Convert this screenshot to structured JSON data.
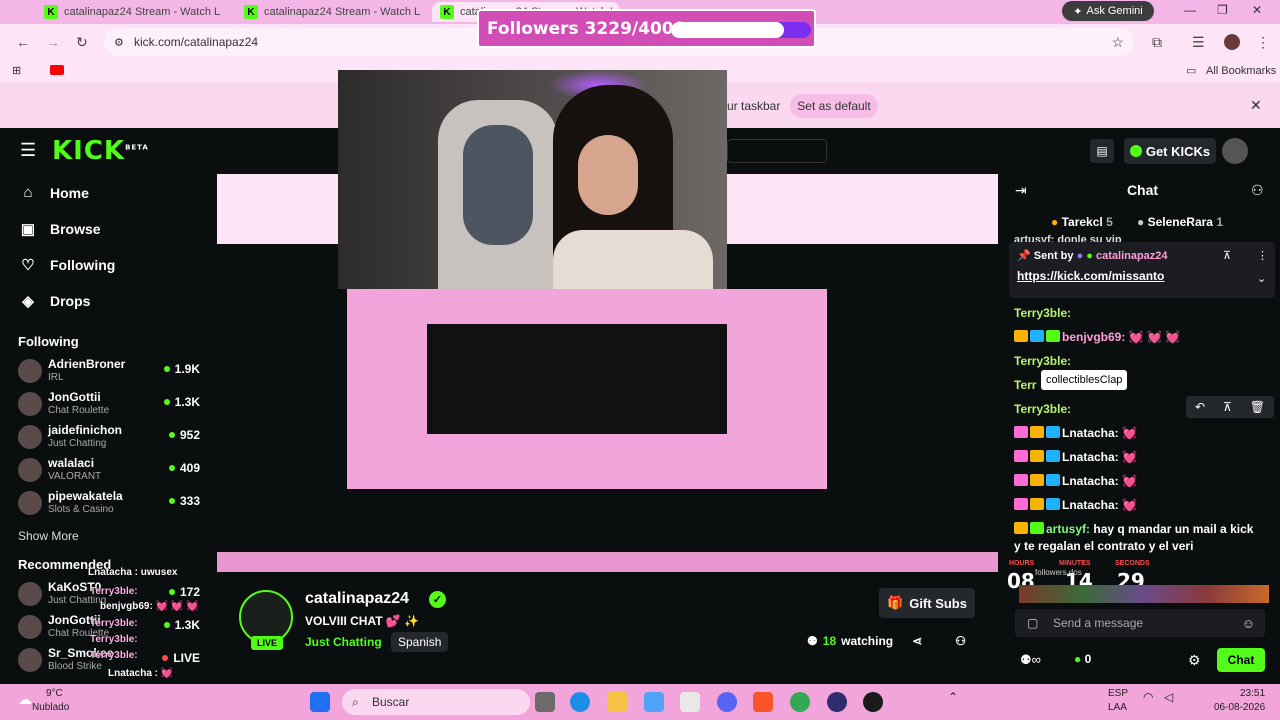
{
  "browser": {
    "tabs": [
      {
        "title": "catalinapaz24 Stream - Watch L",
        "active": false
      },
      {
        "title": "catalinapaz24 Stream - Watch L",
        "active": false
      },
      {
        "title": "catalinapaz24 Stream - Watch L",
        "active": true
      }
    ],
    "ask_gemini": "Ask Gemini",
    "url": "kick.com/catalinapaz24",
    "all_bookmarks": "All Bookmarks",
    "infobar_text": "ur taskbar",
    "set_default": "Set as default"
  },
  "overlay": {
    "followers_label": "Followers 3229/4000",
    "followers_current": 3229,
    "followers_goal": 4000
  },
  "header": {
    "logo": "KICK",
    "logo_beta": "BETA",
    "get_kicks": "Get KICKs"
  },
  "sidebar": {
    "nav": [
      {
        "label": "Home",
        "icon": "home-icon"
      },
      {
        "label": "Browse",
        "icon": "browse-icon"
      },
      {
        "label": "Following",
        "icon": "heart-icon"
      },
      {
        "label": "Drops",
        "icon": "drops-icon"
      }
    ],
    "following_title": "Following",
    "following": [
      {
        "name": "AdrienBroner",
        "category": "IRL",
        "viewers": "1.9K"
      },
      {
        "name": "JonGottii",
        "category": "Chat Roulette",
        "viewers": "1.3K"
      },
      {
        "name": "jaidefinichon",
        "category": "Just Chatting",
        "viewers": "952"
      },
      {
        "name": "walalaci",
        "category": "VALORANT",
        "viewers": "409"
      },
      {
        "name": "pipewakatela",
        "category": "Slots & Casino",
        "viewers": "333"
      }
    ],
    "show_more": "Show More",
    "recommended_title": "Recommended",
    "recommended": [
      {
        "name": "KaKoST0",
        "category": "Just Chatting",
        "viewers": "172"
      },
      {
        "name": "JonGottii",
        "category": "Chat Roulette",
        "viewers": "1.3K"
      },
      {
        "name": "Sr_Smokee",
        "category": "Blood Strike",
        "viewers": "LIVE"
      }
    ]
  },
  "stream": {
    "username": "catalinapaz24",
    "title": "VOLVIII CHAT 💕 ✨",
    "category": "Just Chatting",
    "language": "Spanish",
    "gift_subs": "Gift Subs",
    "watching_count": "18",
    "watching_label": "watching",
    "live_badge": "LIVE"
  },
  "chat": {
    "title": "Chat",
    "top_gifters": [
      {
        "name": "Tarekcl",
        "count": "5"
      },
      {
        "name": "SeleneRara",
        "count": "1"
      }
    ],
    "pinned_partial": "artusyf: donle su vip",
    "pinned_by_label": "Sent by",
    "pinned_by_user": "catalinapaz24",
    "pinned_link": "https://kick.com/missanto",
    "messages": [
      {
        "user": "Terry3ble:",
        "text": ""
      },
      {
        "user": "benjvgb69:",
        "text": "💓 💓 💓"
      },
      {
        "user": "Terry3ble:",
        "text": ""
      },
      {
        "user": "Terr",
        "text": ""
      },
      {
        "user": "Terry3ble:",
        "text": ""
      },
      {
        "user": "Lnatacha:",
        "text": "💓"
      },
      {
        "user": "Lnatacha:",
        "text": "💓"
      },
      {
        "user": "Lnatacha:",
        "text": "💓"
      },
      {
        "user": "Lnatacha:",
        "text": "💓"
      },
      {
        "user": "artusyf:",
        "text": "hay q mandar un mail a kick"
      },
      {
        "user": "",
        "text": "y te regalan el contrato y el veri"
      }
    ],
    "tooltip": "collectiblesClap",
    "countdown": {
      "hours": "08",
      "minutes": "14",
      "seconds": "29",
      "hours_label": "HOURS",
      "minutes_label": "MINUTES",
      "seconds_label": "SECONDS",
      "sub_label": "followers dos"
    },
    "input_placeholder": "Send a message",
    "points": "0",
    "chat_button": "Chat"
  },
  "stream_overlay_chat": [
    {
      "user": "Lnatacha :",
      "text": "uwusex"
    },
    {
      "user": "Terry3ble:",
      "text": ""
    },
    {
      "user": "benjvgb69:",
      "text": "💓 💓 💓"
    },
    {
      "user": "Terry3ble:",
      "text": ""
    },
    {
      "user": "Terry3ble:",
      "text": ""
    },
    {
      "user": "Terry3ble:",
      "text": ""
    },
    {
      "user": "Lnatacha :",
      "text": "💓"
    },
    {
      "user": "Lnatacha :",
      "text": "💓"
    }
  ],
  "taskbar": {
    "weather_temp": "9°C",
    "weather_desc": "Nublado",
    "search": "Buscar",
    "lang": "ESP",
    "lang2": "LAA",
    "time": "23:51",
    "date": "06-08-2026"
  }
}
